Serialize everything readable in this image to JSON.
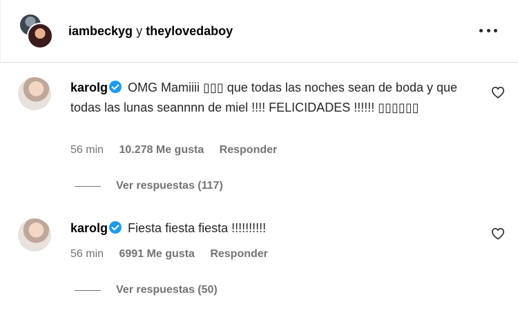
{
  "header": {
    "user1": "iambeckyg",
    "separator": "y",
    "user2": "theylovedaboy"
  },
  "comments": [
    {
      "username": "karolg",
      "text": "OMG Mamiiii ▯▯▯ que todas las noches sean de boda y que todas las lunas seannnn de miel !!!! FELICIDADES !!!!!! ▯▯▯▯▯▯",
      "time": "56 min",
      "likes": "10.278 Me gusta",
      "reply_label": "Responder",
      "view_replies": "Ver respuestas (117)"
    },
    {
      "username": "karolg",
      "text": "Fiesta fiesta fiesta !!!!!!!!!!",
      "time": "56 min",
      "likes": "6991 Me gusta",
      "reply_label": "Responder",
      "view_replies": "Ver respuestas (50)"
    }
  ],
  "icons": {
    "more": "more-options-icon",
    "verified": "verified-badge-icon",
    "like": "heart-icon"
  },
  "colors": {
    "verified": "#1d9bf0",
    "secondary_text": "#737373",
    "divider": "#dbdbdb"
  }
}
